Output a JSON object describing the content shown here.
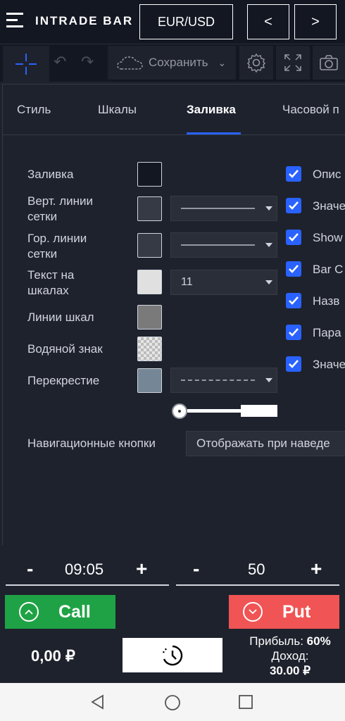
{
  "header": {
    "logo": "INTRADE BAR",
    "pair": "EUR/USD",
    "prev": "<",
    "next": ">"
  },
  "toolbar": {
    "save_label": "Сохранить"
  },
  "dialog": {
    "tabs": [
      "Стиль",
      "Шкалы",
      "Заливка",
      "Часовой п"
    ],
    "rows": [
      {
        "label": "Заливка",
        "color": "#131722"
      },
      {
        "label": "Верт. линии сетки",
        "color": "#363a45"
      },
      {
        "label": "Гор. линии сетки",
        "color": "#363a45"
      },
      {
        "label": "Текст на шкалах",
        "color": "#e0e0e0"
      },
      {
        "label": "Линии шкал",
        "color": "#7a7a7a"
      },
      {
        "label": "Водяной знак",
        "color": "checker"
      },
      {
        "label": "Перекрестие",
        "color": "#758696"
      }
    ],
    "font_size": "11",
    "checkboxes": [
      "Опис",
      "Значе",
      "Show",
      "Bar C",
      "Назв",
      "Пара",
      "Значе"
    ],
    "nav_buttons_label": "Навигационные кнопки",
    "nav_buttons_value": "Отображать при наведе"
  },
  "trade": {
    "time": "09:05",
    "amount": "50",
    "minus": "-",
    "plus": "+",
    "call": "Call",
    "put": "Put",
    "balance": "0,00 ₽",
    "profit_label": "Прибыль:",
    "profit_value": "60%",
    "income_label": "Доход:",
    "income_value": "30.00 ₽"
  },
  "colors": {
    "accent": "#2962ff",
    "call": "#1fa245",
    "put": "#f05454"
  }
}
